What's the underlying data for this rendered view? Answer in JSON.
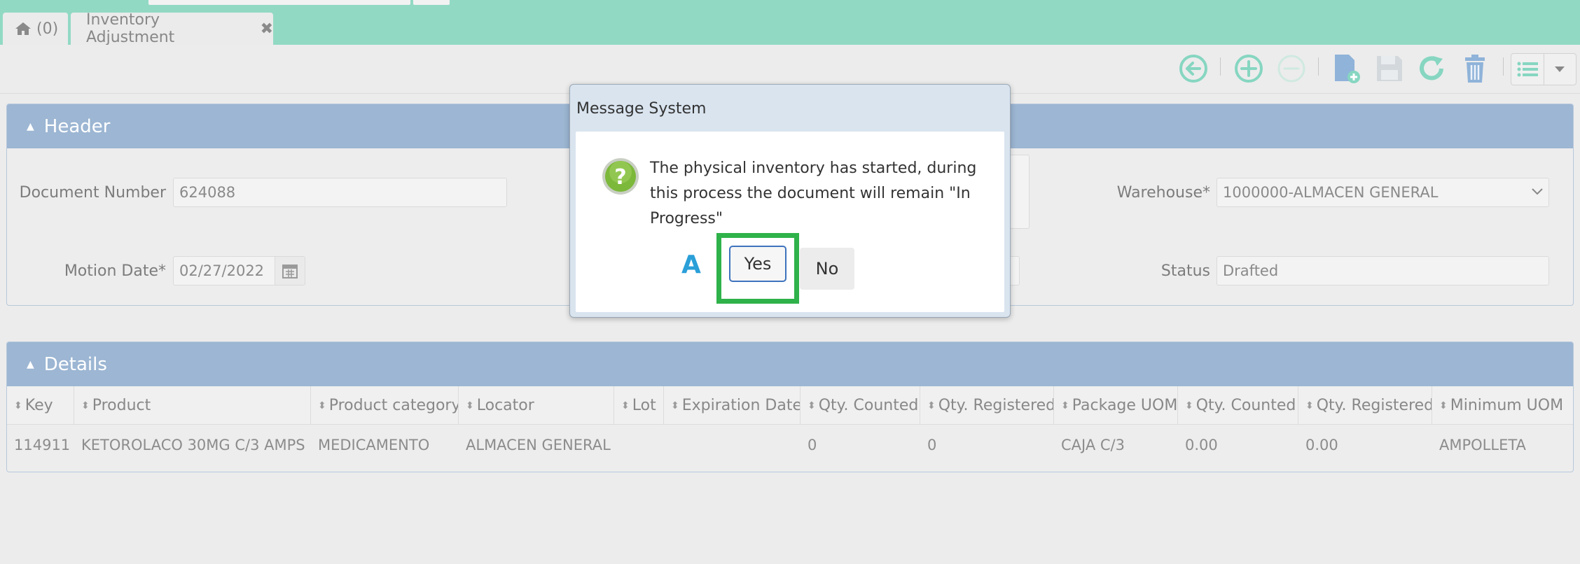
{
  "tabs": {
    "home_label": "(0)",
    "inventory_label": "Inventory Adjustment",
    "close_glyph": "✖"
  },
  "toolbar": {
    "icons": [
      "back-circle-icon",
      "add-circle-icon",
      "remove-circle-icon",
      "new-document-icon",
      "save-icon",
      "refresh-icon",
      "trash-icon",
      "list-icon",
      "chevron-down-icon"
    ]
  },
  "header": {
    "title": "Header",
    "document_number_label": "Document Number",
    "document_number_value": "624088",
    "motion_date_label": "Motion Date*",
    "motion_date_value": "02/27/2022",
    "warehouse_label": "Warehouse*",
    "warehouse_value": "1000000-ALMACEN GENERAL",
    "status_label": "Status",
    "status_value": "Drafted"
  },
  "details": {
    "title": "Details",
    "columns": [
      "Key",
      "Product",
      "Product category",
      "Locator",
      "Lot",
      "Expiration Date",
      "Qty. Counted",
      "Qty. Registered",
      "Package UOM",
      "Qty. Counted",
      "Qty. Registered",
      "Minimum UOM"
    ],
    "rows": [
      [
        "114911",
        "KETOROLACO 30MG C/3 AMPS",
        "MEDICAMENTO",
        "ALMACEN GENERAL",
        "",
        "",
        "0",
        "0",
        "CAJA C/3",
        "0.00",
        "0.00",
        "AMPOLLETA"
      ]
    ]
  },
  "dialog": {
    "title": "Message System",
    "message": "The physical inventory has started, during this process the document will remain \"In Progress\"",
    "marker": "A",
    "yes_label": "Yes",
    "no_label": "No"
  },
  "colors": {
    "topbar": "#92d9c4",
    "panel_header": "#9cb6d3",
    "toolbar_icon": "#86d6c1",
    "highlight": "#2fb24a",
    "marker": "#2a9fd8"
  }
}
